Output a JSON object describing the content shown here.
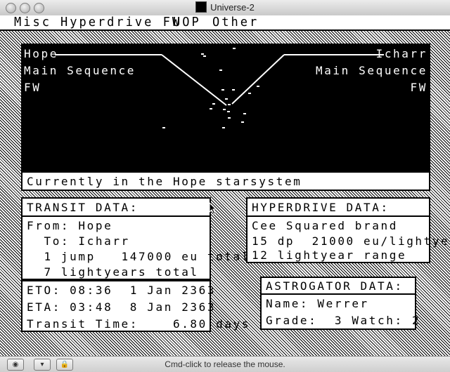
{
  "window": {
    "title": "Universe-2"
  },
  "menu": [
    "Misc",
    "Hyperdrive FW",
    "UOP",
    "Other"
  ],
  "map": {
    "origin": {
      "name": "Hope",
      "class": "Main Sequence",
      "tag": "FW"
    },
    "destination": {
      "name": "Icharr",
      "class": "Main Sequence",
      "tag": "FW"
    }
  },
  "status": "Currently in the Hope starsystem",
  "transit": {
    "title": "TRANSIT DATA:",
    "from": "From: Hope",
    "to": "  To: Icharr",
    "jumps": "  1 jump   147000 eu total",
    "lightyears": "  7 lightyears total"
  },
  "times": {
    "eto": "ETO: 08:36  1 Jan 2363",
    "eta": "ETA: 03:48  8 Jan 2363",
    "transit_time": "Transit Time:    6.80 days"
  },
  "hyperdrive": {
    "title": "HYPERDRIVE DATA:",
    "brand": "Cee Squared brand",
    "power": "15 dp  21000 eu/lightyear",
    "range": "12 lightyear range"
  },
  "astrogator": {
    "title": "ASTROGATOR DATA:",
    "name": "Name: Werrer",
    "grade": "Grade:  3 Watch: 2"
  },
  "bottom_bar": {
    "hint": "Cmd-click to release the mouse."
  },
  "icons": [
    "close-icon",
    "minimize-icon",
    "zoom-icon",
    "app-icon",
    "cd-icon",
    "floppy-icon",
    "lock-icon"
  ]
}
